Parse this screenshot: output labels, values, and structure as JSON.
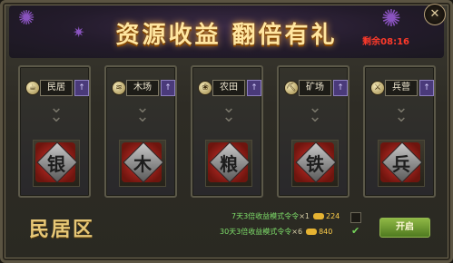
{
  "header": {
    "title": "资源收益 翻倍有礼",
    "countdown": "剩余08:16"
  },
  "cards": [
    {
      "icon": "cup-icon",
      "name": "民居",
      "emblem": "银"
    },
    {
      "icon": "wood-icon",
      "name": "木场",
      "emblem": "木"
    },
    {
      "icon": "grain-icon",
      "name": "农田",
      "emblem": "粮"
    },
    {
      "icon": "mine-icon",
      "name": "矿场",
      "emblem": "铁"
    },
    {
      "icon": "soldier-icon",
      "name": "兵营",
      "emblem": "兵"
    }
  ],
  "region": "民居区",
  "offers": [
    {
      "label_a": "7天3倍收益模式令令",
      "qty": "×1",
      "price": "224"
    },
    {
      "label_b": "30天3倍收益模式令令",
      "qty": "×6",
      "price": "840"
    }
  ],
  "start_label": "开启"
}
